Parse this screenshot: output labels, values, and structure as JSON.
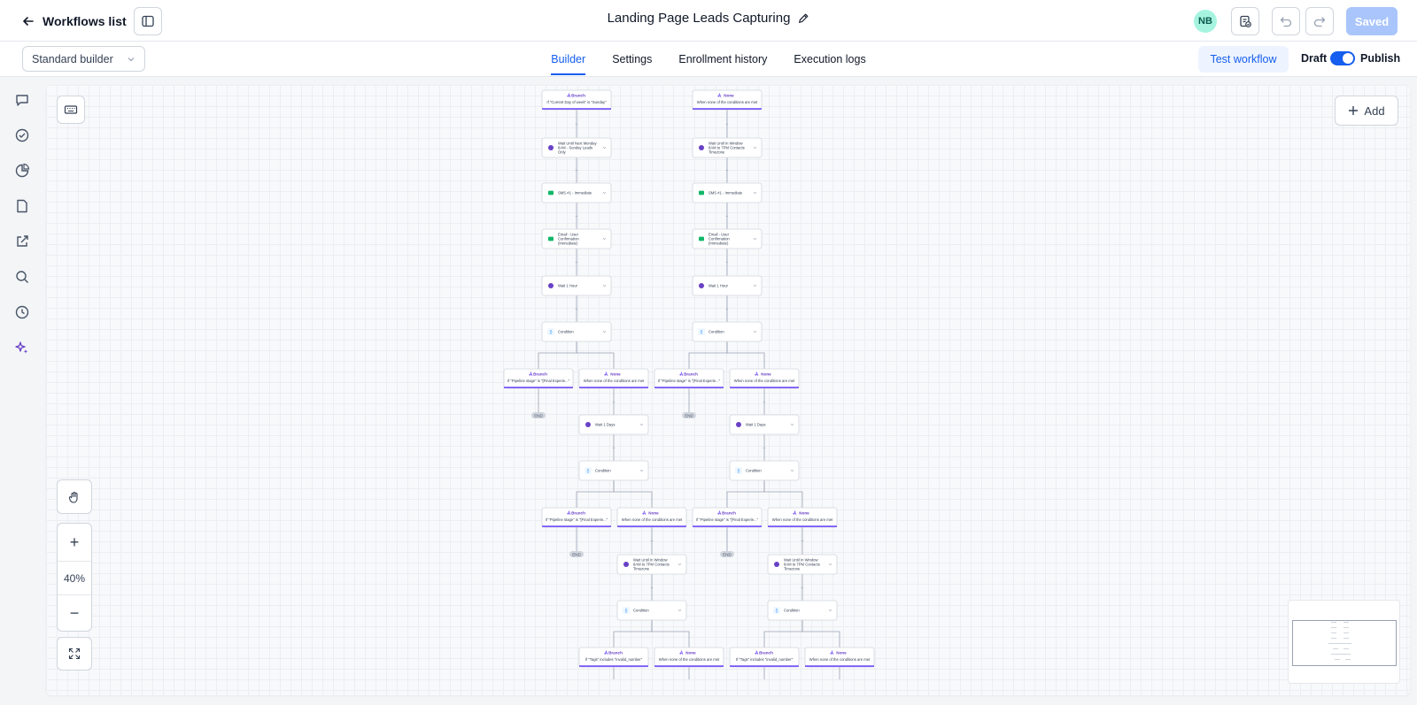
{
  "header": {
    "back_label": "Workflows list",
    "workflow_title": "Landing Page Leads Capturing",
    "avatar_initials": "NB",
    "saved_label": "Saved"
  },
  "subbar": {
    "builder_select_value": "Standard builder",
    "tabs": [
      {
        "label": "Builder",
        "active": true
      },
      {
        "label": "Settings",
        "active": false
      },
      {
        "label": "Enrollment history",
        "active": false
      },
      {
        "label": "Execution logs",
        "active": false
      }
    ],
    "test_workflow_label": "Test workflow",
    "draft_label": "Draft",
    "publish_label": "Publish",
    "publish_toggle_on": true
  },
  "canvas": {
    "add_label": "Add",
    "zoom_level": "40%",
    "zoom_in": "+",
    "zoom_out": "−",
    "nodes": [
      {
        "kind": "branch",
        "title": "Branch",
        "text": "If \"Current Day of week\" is \"Sunday\""
      },
      {
        "kind": "branch",
        "title": "None",
        "text": "When none of the conditions are met"
      },
      {
        "kind": "wait",
        "text": "Wait Until Next Monday 8AM - Sunday Leads Only"
      },
      {
        "kind": "wait",
        "text": "Wait Until In Window 8AM to 7PM Contacts Timezone"
      },
      {
        "kind": "sms",
        "text": "SMS #1 - Immediate"
      },
      {
        "kind": "sms",
        "text": "SMS #1 - Immediate"
      },
      {
        "kind": "email",
        "text": "Email - User Confirmation (Immediate)"
      },
      {
        "kind": "email",
        "text": "Email - User Confirmation (Immediate)"
      },
      {
        "kind": "wait",
        "text": "Wait 1 Hour"
      },
      {
        "kind": "wait",
        "text": "Wait 1 Hour"
      },
      {
        "kind": "condition",
        "text": "Condition"
      },
      {
        "kind": "condition",
        "text": "Condition"
      },
      {
        "kind": "branch",
        "title": "Branch",
        "text": "If \"Pipeline stage\" is \"[Final Experie...\""
      },
      {
        "kind": "branch",
        "title": "None",
        "text": "When none of the conditions are met"
      },
      {
        "kind": "branch",
        "title": "Branch",
        "text": "If \"Pipeline stage\" is \"[Final Experie...\""
      },
      {
        "kind": "branch",
        "title": "None",
        "text": "When none of the conditions are met"
      },
      {
        "kind": "wait",
        "text": "Wait 1 Days"
      },
      {
        "kind": "wait",
        "text": "Wait 1 Days"
      },
      {
        "kind": "condition",
        "text": "Condition"
      },
      {
        "kind": "condition",
        "text": "Condition"
      },
      {
        "kind": "branch",
        "title": "Branch",
        "text": "If \"Pipeline stage\" is \"[Final Experie...\""
      },
      {
        "kind": "branch",
        "title": "None",
        "text": "When none of the conditions are met"
      },
      {
        "kind": "branch",
        "title": "Branch",
        "text": "If \"Pipeline stage\" is \"[Final Experie...\""
      },
      {
        "kind": "branch",
        "title": "None",
        "text": "When none of the conditions are met"
      },
      {
        "kind": "wait",
        "text": "Wait Until In Window 8AM to 7PM Contacts Timezone"
      },
      {
        "kind": "wait",
        "text": "Wait Until In Window 8AM to 7PM Contacts Timezone"
      },
      {
        "kind": "condition",
        "text": "Condition"
      },
      {
        "kind": "condition",
        "text": "Condition"
      },
      {
        "kind": "branch",
        "title": "Branch",
        "text": "If \"Tags\" includes \"invalid_number\""
      },
      {
        "kind": "branch",
        "title": "None",
        "text": "When none of the conditions are met"
      },
      {
        "kind": "branch",
        "title": "Branch",
        "text": "If \"Tags\" includes \"invalid_number\""
      },
      {
        "kind": "branch",
        "title": "None",
        "text": "When none of the conditions are met"
      }
    ],
    "end_label": "END"
  },
  "icons": {
    "back": "arrow-left-icon",
    "sidebar_toggle": "sidebar-panel-icon",
    "edit_title": "pencil-icon",
    "history": "clipboard-check-icon",
    "undo": "undo-icon",
    "redo": "redo-icon",
    "rail": [
      "chat-icon",
      "check-circle-icon",
      "pie-chart-icon",
      "document-icon",
      "external-link-icon",
      "search-icon",
      "clock-history-icon",
      "sparkles-icon"
    ]
  },
  "colors": {
    "accent": "#155eef",
    "branch": "#7a5af8",
    "sms": "#12b76a",
    "wait": "#6941c6",
    "condition": "#2e90fa"
  }
}
